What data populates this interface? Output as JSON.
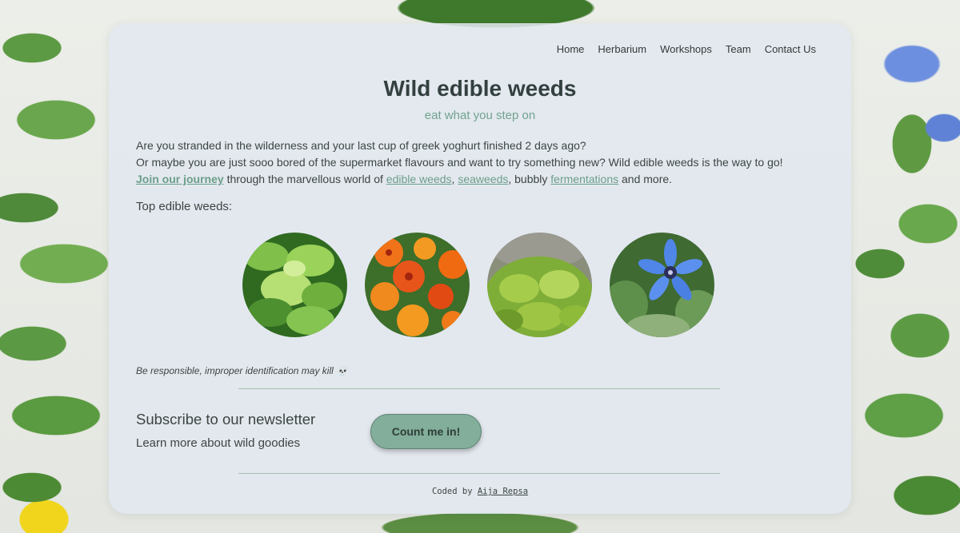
{
  "nav": {
    "items": [
      "Home",
      "Herbarium",
      "Workshops",
      "Team",
      "Contact Us"
    ]
  },
  "hero": {
    "title": "Wild edible weeds",
    "subtitle": "eat what you step on"
  },
  "intro": {
    "line1": "Are you stranded in the wilderness and your last cup of greek yoghurt finished 2 days ago?",
    "line2": "Or maybe you are just sooo bored of the supermarket flavours and want to try something new? Wild edible weeds is the way to go!",
    "join_link": "Join our journey",
    "line3_a": " through the marvellous world of ",
    "link_edible": "edible weeds",
    "sep1": ", ",
    "link_seaweeds": "seaweeds",
    "line3_b": ", bubbly ",
    "link_fermentations": "fermentations",
    "line3_c": " and more."
  },
  "gallery": {
    "label": "Top edible weeds:"
  },
  "warning": {
    "text": "Be responsible, improper identification may kill 💀"
  },
  "newsletter": {
    "title": "Subscribe to our newsletter",
    "subtitle": "Learn more about wild goodies",
    "button_label": "Count me in!"
  },
  "footer": {
    "prefix": "Coded by ",
    "author": "Aija Repsa"
  },
  "colors": {
    "accent": "#72a28e",
    "button": "#82ae9b"
  }
}
